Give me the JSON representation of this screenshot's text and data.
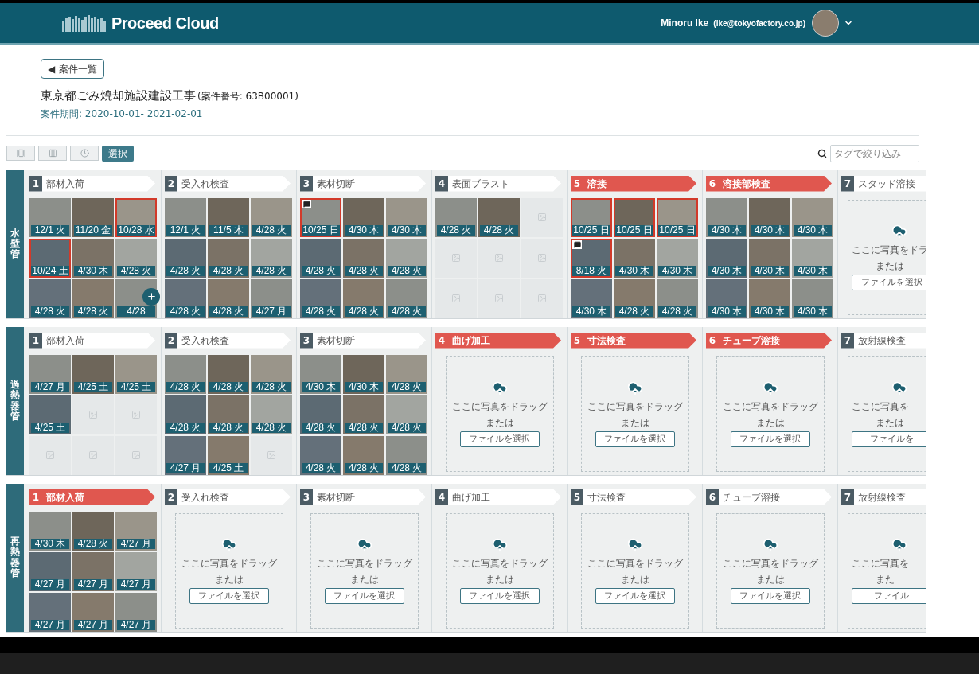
{
  "header": {
    "brand": "Proceed Cloud",
    "user_name": "Minoru Ike",
    "user_email": "(ike@tokyofactory.co.jp)"
  },
  "back_button": {
    "arrow": "◀",
    "label": "案件一覧"
  },
  "project": {
    "title": "東京都ごみ焼却施設建設工事",
    "number": "(案件番号: 63B00001)",
    "period": "案件期間: 2020-10-01- 2021-02-01"
  },
  "toolbar": {
    "select_button": "選択",
    "search": {
      "placeholder": "タグで絞り込み"
    }
  },
  "lanes": [
    {
      "label": "水壁管",
      "steps": [
        {
          "number": "1",
          "name": "部材入荷",
          "selected": false,
          "content": {
            "kind": "photos",
            "tiles": [
              {
                "kind": "photo",
                "date": "12/1 火",
                "flagged": false,
                "comment": false,
                "add_button": false
              },
              {
                "kind": "photo",
                "date": "11/20 金",
                "flagged": false,
                "comment": false,
                "add_button": false
              },
              {
                "kind": "photo",
                "date": "10/28 水",
                "flagged": true,
                "comment": false,
                "add_button": false
              },
              {
                "kind": "photo",
                "date": "10/24 土",
                "flagged": true,
                "comment": false,
                "add_button": false
              },
              {
                "kind": "photo",
                "date": "4/30 木",
                "flagged": false,
                "comment": false,
                "add_button": false
              },
              {
                "kind": "photo",
                "date": "4/28 火",
                "flagged": false,
                "comment": false,
                "add_button": false
              },
              {
                "kind": "photo",
                "date": "4/28 火",
                "flagged": false,
                "comment": false,
                "add_button": false
              },
              {
                "kind": "photo",
                "date": "4/28 火",
                "flagged": false,
                "comment": false,
                "add_button": false
              },
              {
                "kind": "photo",
                "date": "4/28",
                "flagged": false,
                "comment": false,
                "add_button": true
              }
            ]
          }
        },
        {
          "number": "2",
          "name": "受入れ検査",
          "selected": false,
          "content": {
            "kind": "photos",
            "tiles": [
              {
                "kind": "photo",
                "date": "12/1 火",
                "flagged": false,
                "comment": false,
                "add_button": false
              },
              {
                "kind": "photo",
                "date": "11/5 木",
                "flagged": false,
                "comment": false,
                "add_button": false
              },
              {
                "kind": "photo",
                "date": "4/28 火",
                "flagged": false,
                "comment": false,
                "add_button": false
              },
              {
                "kind": "photo",
                "date": "4/28 火",
                "flagged": false,
                "comment": false,
                "add_button": false
              },
              {
                "kind": "photo",
                "date": "4/28 火",
                "flagged": false,
                "comment": false,
                "add_button": false
              },
              {
                "kind": "photo",
                "date": "4/28 火",
                "flagged": false,
                "comment": false,
                "add_button": false
              },
              {
                "kind": "photo",
                "date": "4/28 火",
                "flagged": false,
                "comment": false,
                "add_button": false
              },
              {
                "kind": "photo",
                "date": "4/28 火",
                "flagged": false,
                "comment": false,
                "add_button": false
              },
              {
                "kind": "photo",
                "date": "4/27 月",
                "flagged": false,
                "comment": false,
                "add_button": false
              }
            ]
          }
        },
        {
          "number": "3",
          "name": "素材切断",
          "selected": false,
          "content": {
            "kind": "photos",
            "tiles": [
              {
                "kind": "photo",
                "date": "10/25 日",
                "flagged": true,
                "comment": true,
                "add_button": false
              },
              {
                "kind": "photo",
                "date": "4/30 木",
                "flagged": false,
                "comment": false,
                "add_button": false
              },
              {
                "kind": "photo",
                "date": "4/30 木",
                "flagged": false,
                "comment": false,
                "add_button": false
              },
              {
                "kind": "photo",
                "date": "4/28 火",
                "flagged": false,
                "comment": false,
                "add_button": false
              },
              {
                "kind": "photo",
                "date": "4/28 火",
                "flagged": false,
                "comment": false,
                "add_button": false
              },
              {
                "kind": "photo",
                "date": "4/28 火",
                "flagged": false,
                "comment": false,
                "add_button": false
              },
              {
                "kind": "photo",
                "date": "4/28 火",
                "flagged": false,
                "comment": false,
                "add_button": false
              },
              {
                "kind": "photo",
                "date": "4/28 火",
                "flagged": false,
                "comment": false,
                "add_button": false
              },
              {
                "kind": "photo",
                "date": "4/28 火",
                "flagged": false,
                "comment": false,
                "add_button": false
              }
            ]
          }
        },
        {
          "number": "4",
          "name": "表面ブラスト",
          "selected": false,
          "content": {
            "kind": "photos",
            "tiles": [
              {
                "kind": "photo",
                "date": "4/28 火",
                "flagged": false,
                "comment": false,
                "add_button": false
              },
              {
                "kind": "photo",
                "date": "4/28 火",
                "flagged": false,
                "comment": false,
                "add_button": false
              },
              {
                "kind": "empty"
              },
              {
                "kind": "empty"
              },
              {
                "kind": "empty"
              },
              {
                "kind": "empty"
              },
              {
                "kind": "empty"
              },
              {
                "kind": "empty"
              },
              {
                "kind": "empty"
              }
            ]
          }
        },
        {
          "number": "5",
          "name": "溶接",
          "selected": true,
          "content": {
            "kind": "photos",
            "tiles": [
              {
                "kind": "photo",
                "date": "10/25 日",
                "flagged": true,
                "comment": false,
                "add_button": false
              },
              {
                "kind": "photo",
                "date": "10/25 日",
                "flagged": true,
                "comment": false,
                "add_button": false
              },
              {
                "kind": "photo",
                "date": "10/25 日",
                "flagged": true,
                "comment": false,
                "add_button": false
              },
              {
                "kind": "photo",
                "date": "8/18 火",
                "flagged": true,
                "comment": true,
                "add_button": false
              },
              {
                "kind": "photo",
                "date": "4/30 木",
                "flagged": false,
                "comment": false,
                "add_button": false
              },
              {
                "kind": "photo",
                "date": "4/30 木",
                "flagged": false,
                "comment": false,
                "add_button": false
              },
              {
                "kind": "photo",
                "date": "4/30 木",
                "flagged": false,
                "comment": false,
                "add_button": false
              },
              {
                "kind": "photo",
                "date": "4/28 火",
                "flagged": false,
                "comment": false,
                "add_button": false
              },
              {
                "kind": "photo",
                "date": "4/28 火",
                "flagged": false,
                "comment": false,
                "add_button": false
              }
            ]
          }
        },
        {
          "number": "6",
          "name": "溶接部検査",
          "selected": true,
          "content": {
            "kind": "photos",
            "tiles": [
              {
                "kind": "photo",
                "date": "4/30 木",
                "flagged": false,
                "comment": false,
                "add_button": false
              },
              {
                "kind": "photo",
                "date": "4/30 木",
                "flagged": false,
                "comment": false,
                "add_button": false
              },
              {
                "kind": "photo",
                "date": "4/30 木",
                "flagged": false,
                "comment": false,
                "add_button": false
              },
              {
                "kind": "photo",
                "date": "4/30 木",
                "flagged": false,
                "comment": false,
                "add_button": false
              },
              {
                "kind": "photo",
                "date": "4/30 木",
                "flagged": false,
                "comment": false,
                "add_button": false
              },
              {
                "kind": "photo",
                "date": "4/30 木",
                "flagged": false,
                "comment": false,
                "add_button": false
              },
              {
                "kind": "photo",
                "date": "4/30 木",
                "flagged": false,
                "comment": false,
                "add_button": false
              },
              {
                "kind": "photo",
                "date": "4/30 木",
                "flagged": false,
                "comment": false,
                "add_button": false
              },
              {
                "kind": "photo",
                "date": "4/30 木",
                "flagged": false,
                "comment": false,
                "add_button": false
              }
            ]
          }
        },
        {
          "number": "7",
          "name": "スタッド溶接",
          "selected": false,
          "content": {
            "kind": "upload",
            "prompt": "ここに写真をドラ",
            "or": "または",
            "button": "ファイルを選択"
          }
        }
      ]
    },
    {
      "label": "過熱器管",
      "steps": [
        {
          "number": "1",
          "name": "部材入荷",
          "selected": false,
          "content": {
            "kind": "photos",
            "tiles": [
              {
                "kind": "photo",
                "date": "4/27 月",
                "flagged": false,
                "comment": false,
                "add_button": false
              },
              {
                "kind": "photo",
                "date": "4/25 土",
                "flagged": false,
                "comment": false,
                "add_button": false
              },
              {
                "kind": "photo",
                "date": "4/25 土",
                "flagged": false,
                "comment": false,
                "add_button": false
              },
              {
                "kind": "photo",
                "date": "4/25 土",
                "flagged": false,
                "comment": false,
                "add_button": false
              },
              {
                "kind": "empty"
              },
              {
                "kind": "empty"
              },
              {
                "kind": "empty"
              },
              {
                "kind": "empty"
              },
              {
                "kind": "empty"
              }
            ]
          }
        },
        {
          "number": "2",
          "name": "受入れ検査",
          "selected": false,
          "content": {
            "kind": "photos",
            "tiles": [
              {
                "kind": "photo",
                "date": "4/28 火",
                "flagged": false,
                "comment": false,
                "add_button": false
              },
              {
                "kind": "photo",
                "date": "4/28 火",
                "flagged": false,
                "comment": false,
                "add_button": false
              },
              {
                "kind": "photo",
                "date": "4/28 火",
                "flagged": false,
                "comment": false,
                "add_button": false
              },
              {
                "kind": "photo",
                "date": "4/28 火",
                "flagged": false,
                "comment": false,
                "add_button": false
              },
              {
                "kind": "photo",
                "date": "4/28 火",
                "flagged": false,
                "comment": false,
                "add_button": false
              },
              {
                "kind": "photo",
                "date": "4/28 火",
                "flagged": false,
                "comment": false,
                "add_button": false
              },
              {
                "kind": "photo",
                "date": "4/27 月",
                "flagged": false,
                "comment": false,
                "add_button": false
              },
              {
                "kind": "photo",
                "date": "4/25 土",
                "flagged": false,
                "comment": false,
                "add_button": false
              },
              {
                "kind": "empty"
              }
            ]
          }
        },
        {
          "number": "3",
          "name": "素材切断",
          "selected": false,
          "content": {
            "kind": "photos",
            "tiles": [
              {
                "kind": "photo",
                "date": "4/30 木",
                "flagged": false,
                "comment": false,
                "add_button": false
              },
              {
                "kind": "photo",
                "date": "4/30 木",
                "flagged": false,
                "comment": false,
                "add_button": false
              },
              {
                "kind": "photo",
                "date": "4/28 火",
                "flagged": false,
                "comment": false,
                "add_button": false
              },
              {
                "kind": "photo",
                "date": "4/28 火",
                "flagged": false,
                "comment": false,
                "add_button": false
              },
              {
                "kind": "photo",
                "date": "4/28 火",
                "flagged": false,
                "comment": false,
                "add_button": false
              },
              {
                "kind": "photo",
                "date": "4/28 火",
                "flagged": false,
                "comment": false,
                "add_button": false
              },
              {
                "kind": "photo",
                "date": "4/28 火",
                "flagged": false,
                "comment": false,
                "add_button": false
              },
              {
                "kind": "photo",
                "date": "4/28 火",
                "flagged": false,
                "comment": false,
                "add_button": false
              },
              {
                "kind": "photo",
                "date": "4/28 火",
                "flagged": false,
                "comment": false,
                "add_button": false
              }
            ]
          }
        },
        {
          "number": "4",
          "name": "曲げ加工",
          "selected": true,
          "content": {
            "kind": "upload",
            "prompt": "ここに写真をドラッグ",
            "or": "または",
            "button": "ファイルを選択"
          }
        },
        {
          "number": "5",
          "name": "寸法検査",
          "selected": true,
          "content": {
            "kind": "upload",
            "prompt": "ここに写真をドラッグ",
            "or": "または",
            "button": "ファイルを選択"
          }
        },
        {
          "number": "6",
          "name": "チューブ溶接",
          "selected": true,
          "content": {
            "kind": "upload",
            "prompt": "ここに写真をドラッグ",
            "or": "または",
            "button": "ファイルを選択"
          }
        },
        {
          "number": "7",
          "name": "放射線検査",
          "selected": false,
          "content": {
            "kind": "upload",
            "prompt": "ここに写真を",
            "or": "または",
            "button": "ファイルを"
          }
        }
      ]
    },
    {
      "label": "再熱器管",
      "steps": [
        {
          "number": "1",
          "name": "部材入荷",
          "selected": true,
          "content": {
            "kind": "photos",
            "tiles": [
              {
                "kind": "photo",
                "date": "4/30 木",
                "flagged": false,
                "comment": false,
                "add_button": false
              },
              {
                "kind": "photo",
                "date": "4/28 火",
                "flagged": false,
                "comment": false,
                "add_button": false
              },
              {
                "kind": "photo",
                "date": "4/27 月",
                "flagged": false,
                "comment": false,
                "add_button": false
              },
              {
                "kind": "photo",
                "date": "4/27 月",
                "flagged": false,
                "comment": false,
                "add_button": false
              },
              {
                "kind": "photo",
                "date": "4/27 月",
                "flagged": false,
                "comment": false,
                "add_button": false
              },
              {
                "kind": "photo",
                "date": "4/27 月",
                "flagged": false,
                "comment": false,
                "add_button": false
              },
              {
                "kind": "photo",
                "date": "4/27 月",
                "flagged": false,
                "comment": false,
                "add_button": false
              },
              {
                "kind": "photo",
                "date": "4/27 月",
                "flagged": false,
                "comment": false,
                "add_button": false
              },
              {
                "kind": "photo",
                "date": "4/27 月",
                "flagged": false,
                "comment": false,
                "add_button": false
              }
            ]
          }
        },
        {
          "number": "2",
          "name": "受入れ検査",
          "selected": false,
          "content": {
            "kind": "upload",
            "prompt": "ここに写真をドラッグ",
            "or": "または",
            "button": "ファイルを選択"
          }
        },
        {
          "number": "3",
          "name": "素材切断",
          "selected": false,
          "content": {
            "kind": "upload",
            "prompt": "ここに写真をドラッグ",
            "or": "または",
            "button": "ファイルを選択"
          }
        },
        {
          "number": "4",
          "name": "曲げ加工",
          "selected": false,
          "content": {
            "kind": "upload",
            "prompt": "ここに写真をドラッグ",
            "or": "または",
            "button": "ファイルを選択"
          }
        },
        {
          "number": "5",
          "name": "寸法検査",
          "selected": false,
          "content": {
            "kind": "upload",
            "prompt": "ここに写真をドラッグ",
            "or": "または",
            "button": "ファイルを選択"
          }
        },
        {
          "number": "6",
          "name": "チューブ溶接",
          "selected": false,
          "content": {
            "kind": "upload",
            "prompt": "ここに写真をドラッグ",
            "or": "または",
            "button": "ファイルを選択"
          }
        },
        {
          "number": "7",
          "name": "放射線検査",
          "selected": false,
          "content": {
            "kind": "upload",
            "prompt": "ここに写真を",
            "or": "また",
            "button": "ファイル"
          }
        }
      ]
    }
  ]
}
